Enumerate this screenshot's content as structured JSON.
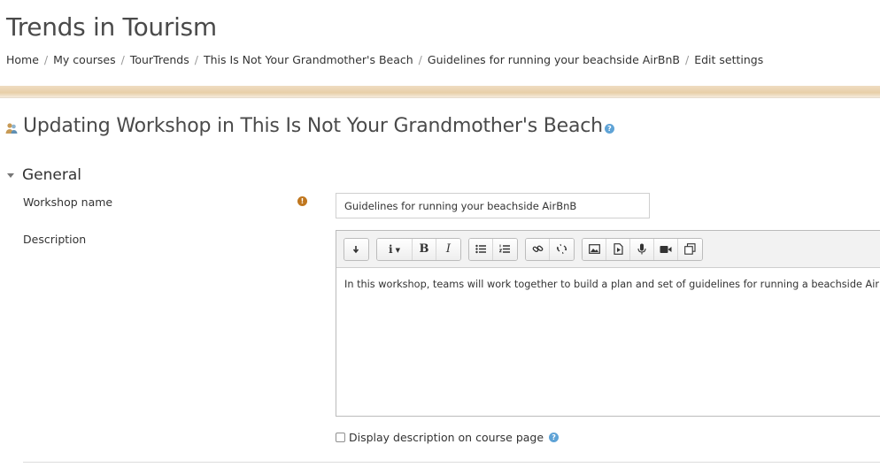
{
  "site": {
    "title": "Trends in Tourism"
  },
  "breadcrumb": [
    "Home",
    "My courses",
    "TourTrends",
    "This Is Not Your Grandmother's Beach",
    "Guidelines for running your beachside AirBnB",
    "Edit settings"
  ],
  "breadcrumb_separator": "/",
  "heading": {
    "text": "Updating Workshop in This Is Not Your Grandmother's Beach",
    "icon": "workshop-icon",
    "help_icon": "help-icon"
  },
  "section": {
    "label": "General"
  },
  "fields": {
    "workshop_name": {
      "label": "Workshop name",
      "value": "Guidelines for running your beachside AirBnB",
      "required_icon": "required-icon"
    },
    "description": {
      "label": "Description",
      "content": "In this workshop, teams will work together to build a plan and set of guidelines for running a beachside AirBnB."
    },
    "display_description": {
      "label": "Display description on course page",
      "checked": false
    }
  },
  "toolbar": {
    "groups": [
      [
        "collapse-icon"
      ],
      [
        "paragraph-style-icon",
        "bold-icon",
        "italic-icon"
      ],
      [
        "unordered-list-icon",
        "ordered-list-icon"
      ],
      [
        "link-icon",
        "unlink-icon"
      ],
      [
        "image-icon",
        "media-icon",
        "record-audio-icon",
        "record-video-icon",
        "manage-files-icon"
      ]
    ],
    "bold_label": "B",
    "italic_label": "I",
    "style_label": "i"
  },
  "colors": {
    "help": "#5fa3d6",
    "required": "#c0771f",
    "band": "#e8cfa8"
  }
}
